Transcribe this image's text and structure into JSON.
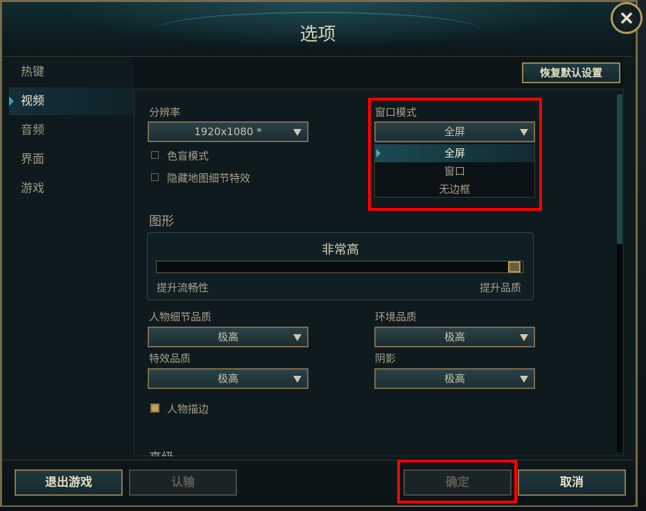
{
  "window": {
    "title": "选项"
  },
  "sidebar": {
    "items": [
      {
        "label": "热键",
        "active": false
      },
      {
        "label": "视频",
        "active": true
      },
      {
        "label": "音频",
        "active": false
      },
      {
        "label": "界面",
        "active": false
      },
      {
        "label": "游戏",
        "active": false
      }
    ]
  },
  "header": {
    "restore_defaults_label": "恢复默认设置"
  },
  "video": {
    "resolution": {
      "label": "分辨率",
      "value": "1920x1080 *"
    },
    "colorblind": {
      "label": "色盲模式",
      "checked": false
    },
    "hide_map_effects": {
      "label": "隐藏地图细节特效",
      "checked": false
    },
    "window_mode": {
      "label": "窗口模式",
      "value": "全屏",
      "options": [
        "全屏",
        "窗口",
        "无边框"
      ],
      "selected_index": 0,
      "open": true
    }
  },
  "graphics": {
    "section_title": "图形",
    "quality_value": "非常高",
    "slider_level": 1.0,
    "left_label": "提升流畅性",
    "right_label": "提升品质",
    "character_quality": {
      "label": "人物细节品质",
      "value": "极高"
    },
    "environment_quality": {
      "label": "环境品质",
      "value": "极高"
    },
    "effects_quality": {
      "label": "特效品质",
      "value": "极高"
    },
    "shadows": {
      "label": "阴影",
      "value": "极高"
    },
    "character_outline": {
      "label": "人物描边",
      "checked": true
    }
  },
  "advanced": {
    "section_title": "高级"
  },
  "footer": {
    "exit_game_label": "退出游戏",
    "surrender_label": "认输",
    "confirm_label": "确定",
    "cancel_label": "取消"
  },
  "colors": {
    "gold_border": "#9a8456",
    "highlight": "#ff0000",
    "accent_teal": "#3e9db0"
  }
}
